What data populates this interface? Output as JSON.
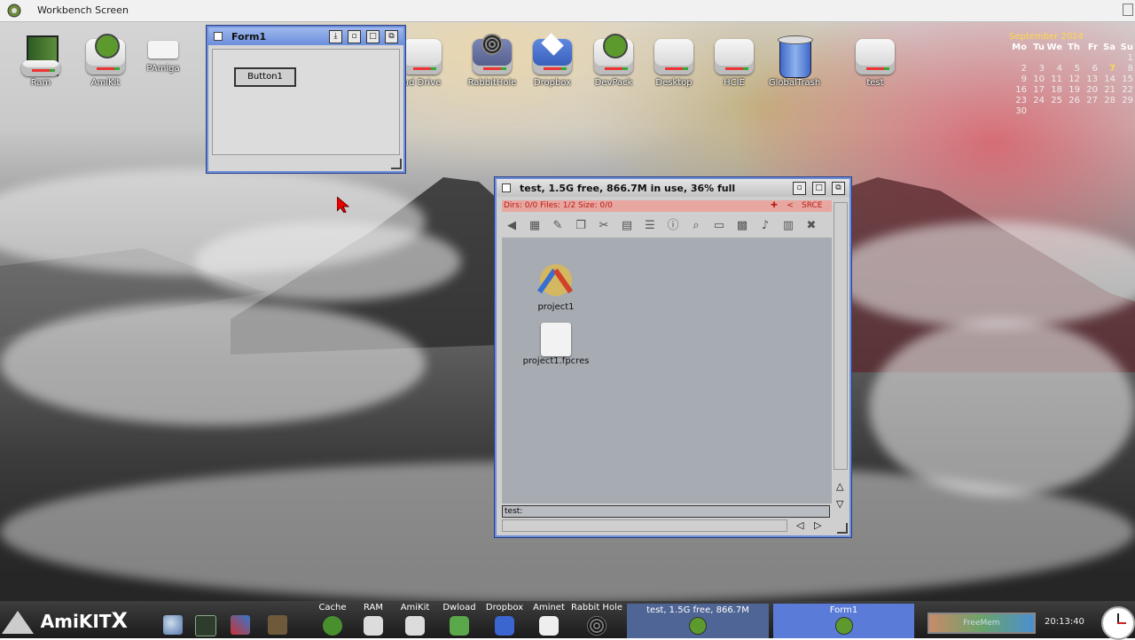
{
  "screen": {
    "title": "Workbench Screen"
  },
  "desktop_icons": [
    {
      "label": "Ram",
      "icon": "ram-icon"
    },
    {
      "label": "AmiKit",
      "icon": "amikit-drive-icon"
    },
    {
      "label": "PAmiga",
      "icon": "pamiga-icon"
    },
    {
      "label": "ud Drive",
      "icon": "cloud-drive-icon"
    },
    {
      "label": "RabbitHole",
      "icon": "rabbithole-icon"
    },
    {
      "label": "Dropbox",
      "icon": "dropbox-icon"
    },
    {
      "label": "DevPack",
      "icon": "devpack-drive-icon"
    },
    {
      "label": "Desktop",
      "icon": "drive-icon"
    },
    {
      "label": "HCIE",
      "icon": "drive-icon"
    },
    {
      "label": "GlobalTrash",
      "icon": "trash-icon"
    },
    {
      "label": "test",
      "icon": "drive-icon"
    }
  ],
  "calendar": {
    "month": "September 2024",
    "days": [
      "Mo",
      "Tu",
      "We",
      "Th",
      "Fr",
      "Sa",
      "Su"
    ],
    "cells": [
      "",
      "",
      "",
      "",
      "",
      "",
      "1",
      "2",
      "3",
      "4",
      "5",
      "6",
      "7",
      "8",
      "9",
      "10",
      "11",
      "12",
      "13",
      "14",
      "15",
      "16",
      "17",
      "18",
      "19",
      "20",
      "21",
      "22",
      "23",
      "24",
      "25",
      "26",
      "27",
      "28",
      "29",
      "30"
    ],
    "today": "7"
  },
  "form_window": {
    "title": "Form1",
    "button_label": "Button1"
  },
  "file_window": {
    "title": "test,  1.5G free, 866.7M in use, 36% full",
    "status": "Dirs: 0/0   Files: 1/2   Size: 0/0",
    "srce": "SRCE",
    "files": [
      {
        "name": "project1",
        "icon": "tools-icon"
      },
      {
        "name": "project1.fpcres",
        "icon": "document-icon"
      }
    ],
    "path": "test:"
  },
  "taskbar": {
    "logo": "AmiKIT",
    "logo_x": "X",
    "dock": [
      {
        "label": "Cache",
        "icon": "accessibility-icon"
      },
      {
        "label": "RAM",
        "icon": "ram-icon"
      },
      {
        "label": "AmiKit",
        "icon": "amikit-icon"
      },
      {
        "label": "Dwload",
        "icon": "download-icon"
      },
      {
        "label": "Dropbox",
        "icon": "dropbox-icon"
      },
      {
        "label": "Aminet",
        "icon": "aminet-icon"
      },
      {
        "label": "Rabbit Hole",
        "icon": "rabbithole-icon"
      }
    ],
    "tasks": [
      {
        "label": "test, 1.5G free, 866.7M"
      },
      {
        "label": "Form1"
      }
    ],
    "freemem": "FreeMem",
    "time": "20:13:40"
  }
}
